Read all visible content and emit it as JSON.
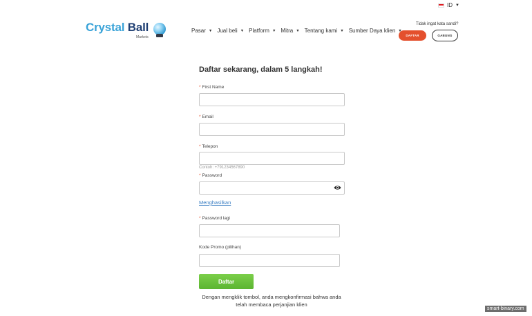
{
  "header": {
    "language": "ID",
    "logo": {
      "brand_part1": "Crystal",
      "brand_part2": "Ball",
      "sub": "Markets"
    },
    "nav": [
      {
        "label": "Pasar"
      },
      {
        "label": "Jual beli"
      },
      {
        "label": "Platform"
      },
      {
        "label": "Mitra"
      },
      {
        "label": "Tentang kami"
      },
      {
        "label": "Sumber Daya klien"
      }
    ],
    "forgot_password": "Tidak ingat kata sandi?",
    "register_button": "DAFTAR",
    "join_button": "GABUNG"
  },
  "form": {
    "title": "Daftar sekarang, dalam 5 langkah!",
    "fields": {
      "first_name": {
        "label": "First Name",
        "value": ""
      },
      "email": {
        "label": "Email",
        "value": ""
      },
      "phone": {
        "label": "Telepon",
        "value": "",
        "hint": "Contoh: +791234567890"
      },
      "password": {
        "label": "Password",
        "value": ""
      },
      "password_again": {
        "label": "Password lagi",
        "value": ""
      },
      "promo": {
        "label": "Kode Promo (pilihan)",
        "value": ""
      }
    },
    "generate_link": "Menghasilkan",
    "submit_label": "Daftar",
    "consent_text": "Dengan mengklik tombol, anda mengkonfirmasi bahwa anda telah membaca perjanjian klien"
  },
  "watermark": "smart-binary.com",
  "colors": {
    "accent": "#e4502d",
    "submit": "#5cb531",
    "link": "#3b7fc4",
    "logo_light": "#3aa3d8",
    "logo_dark": "#1f3f73"
  },
  "icons": {
    "language_flag": "indonesia-flag-icon",
    "password_toggle": "eye-icon"
  }
}
